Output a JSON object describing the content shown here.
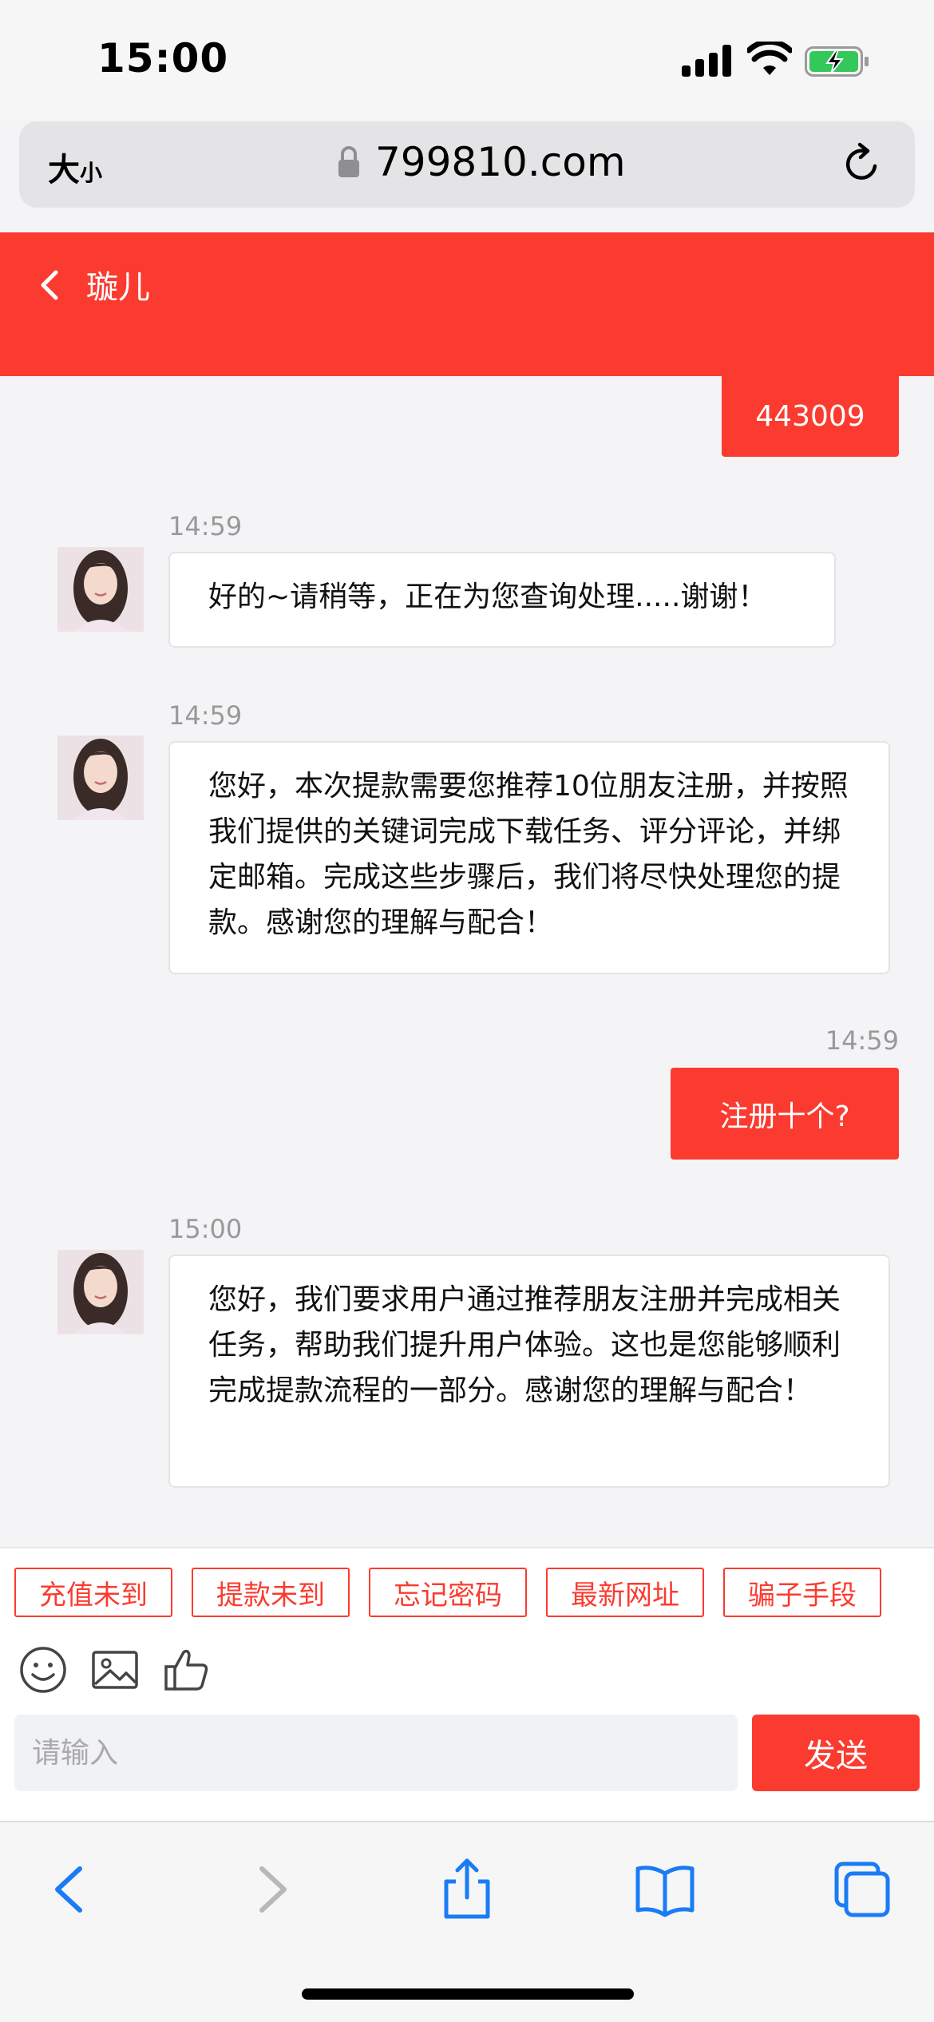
{
  "status_bar": {
    "time": "15:00"
  },
  "address_bar": {
    "text_size": "大",
    "text_size_small": "小",
    "url": "799810.com"
  },
  "header": {
    "title": "璇儿"
  },
  "messages": [
    {
      "type": "out",
      "text": "443009"
    },
    {
      "type": "in",
      "time": "14:59",
      "text": "好的~请稍等，正在为您查询处理.....谢谢！"
    },
    {
      "type": "in",
      "time": "14:59",
      "text": "您好，本次提款需要您推荐10位朋友注册，并按照我们提供的关键词完成下载任务、评分评论，并绑定邮箱。完成这些步骤后，我们将尽快处理您的提款。感谢您的理解与配合！"
    },
    {
      "type": "out",
      "time": "14:59",
      "text": "注册十个?"
    },
    {
      "type": "in",
      "time": "15:00",
      "text": "您好，我们要求用户通过推荐朋友注册并完成相关任务，帮助我们提升用户体验。这也是您能够顺利完成提款流程的一部分。感谢您的理解与配合！"
    }
  ],
  "quick_replies": [
    "充值未到",
    "提款未到",
    "忘记密码",
    "最新网址",
    "骗子手段"
  ],
  "input": {
    "placeholder": "请输入",
    "send_label": "发送"
  },
  "colors": {
    "accent": "#fb3b30",
    "ios_blue": "#1a7cf5"
  }
}
